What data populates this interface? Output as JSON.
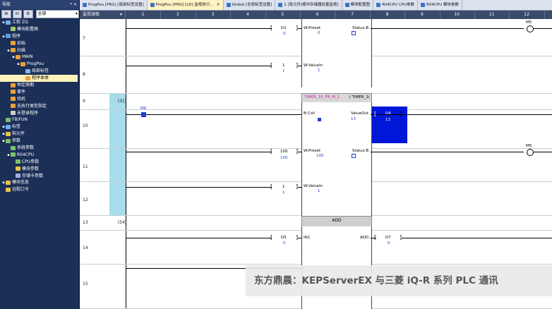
{
  "nav": {
    "title": "导航",
    "pin": "ᵠ ×",
    "select_value": "全部",
    "tree": [
      {
        "label": "工程 ZQ",
        "indent": 0,
        "exp": "▪",
        "color": "#6bb0f0"
      },
      {
        "label": "模块配置图",
        "indent": 1,
        "exp": "",
        "color": "#9cd067"
      },
      {
        "label": "程序",
        "indent": 0,
        "exp": "▪",
        "color": "#5aa0e0"
      },
      {
        "label": "初始",
        "indent": 1,
        "exp": "",
        "color": "#e8a23c"
      },
      {
        "label": "扫描",
        "indent": 1,
        "exp": "▪",
        "color": "#e8a23c"
      },
      {
        "label": "MAIN",
        "indent": 2,
        "exp": "▪",
        "color": "#e8a23c"
      },
      {
        "label": "ProgPou",
        "indent": 3,
        "exp": "▪",
        "color": "#e8a23c"
      },
      {
        "label": "局部标签",
        "indent": 4,
        "exp": "",
        "color": "#7ab3ef"
      },
      {
        "label": "程序本体",
        "indent": 4,
        "exp": "",
        "color": "#e8a23c",
        "selected": true
      },
      {
        "label": "恒定周期",
        "indent": 1,
        "exp": "",
        "color": "#e8a23c"
      },
      {
        "label": "事件",
        "indent": 1,
        "exp": "",
        "color": "#e8a23c"
      },
      {
        "label": "待机",
        "indent": 1,
        "exp": "",
        "color": "#e8a23c"
      },
      {
        "label": "无执行类型指定",
        "indent": 1,
        "exp": "",
        "color": "#e8a23c"
      },
      {
        "label": "未登录程序",
        "indent": 1,
        "exp": "",
        "color": "#cccccc"
      },
      {
        "label": "FB/FUN",
        "indent": 0,
        "exp": "",
        "color": "#7bc06a"
      },
      {
        "label": "标签",
        "indent": 0,
        "exp": "▪",
        "color": "#6bb0f0"
      },
      {
        "label": "软元件",
        "indent": 0,
        "exp": "▪",
        "color": "#e8c34a"
      },
      {
        "label": "参数",
        "indent": 0,
        "exp": "▪",
        "color": "#7bc06a"
      },
      {
        "label": "系统参数",
        "indent": 1,
        "exp": "",
        "color": "#7bc06a"
      },
      {
        "label": "R04CPU",
        "indent": 1,
        "exp": "▪",
        "color": "#7bc06a"
      },
      {
        "label": "CPU参数",
        "indent": 2,
        "exp": "",
        "color": "#7bc06a"
      },
      {
        "label": "模块参数",
        "indent": 2,
        "exp": "",
        "color": "#e8c34a"
      },
      {
        "label": "存储卡参数",
        "indent": 2,
        "exp": "",
        "color": "#9ab4e6"
      },
      {
        "label": "模块信息",
        "indent": 0,
        "exp": "▪",
        "color": "#e8c34a"
      },
      {
        "label": "远程口令",
        "indent": 0,
        "exp": "",
        "color": "#e8c34a"
      }
    ]
  },
  "tabs": [
    {
      "label": "ProgPou [PRG] [局部标签设置]",
      "active": false,
      "close": ""
    },
    {
      "label": "ProgPou [PRG] [LD] 监视执行...",
      "active": true,
      "close": "×"
    },
    {
      "label": "Global [全局标签设置]",
      "active": false,
      "close": ""
    },
    {
      "label": "1 [软元件/缓冲存储器批量监视]",
      "active": false,
      "close": ""
    },
    {
      "label": "模块配置图",
      "active": false,
      "close": ""
    },
    {
      "label": "R04CPU CPU参数",
      "active": false,
      "close": ""
    },
    {
      "label": "R04CPU 模块参数",
      "active": false,
      "close": ""
    }
  ],
  "header": {
    "mode": "监视读取",
    "columns": [
      "1",
      "2",
      "3",
      "4",
      "5",
      "6",
      "7",
      "8",
      "9",
      "10",
      "11",
      "12"
    ]
  },
  "rows": {
    "r7": "7",
    "r8": "8",
    "r9": "9",
    "r10": "10",
    "r11": "11",
    "r12": "12",
    "r13": "13",
    "r14": "14",
    "r15": "15",
    "step9": "(31)",
    "step13": "(54)"
  },
  "ladder": {
    "d1": "D1",
    "d1v": "0",
    "wpreset1": "W:Preset",
    "wpreset1v": "0",
    "statusb1": "Status:B",
    "m5": "M5",
    "one_a": "1",
    "one_av": "1",
    "wvaluein1": "W:ValueIn",
    "wvaluein1v": "1",
    "fbname": "TIMER_10_FB_M_1",
    "fbtype": "( TIMER_1(",
    "m6a": "M6",
    "bcoil": "B:Coil",
    "valueout": "ValueOut",
    "valueoutv": "13",
    "d4": "D4",
    "d4v": "13",
    "m6b": "M6",
    "hundred": "100",
    "hundredv": "100",
    "wpreset2": "W:Preset",
    "wpreset2v": "100",
    "statusb2": "Status:B",
    "one_b": "1",
    "one_bv": "1",
    "wvaluein2": "W:ValueIn",
    "wvaluein2v": "1",
    "add": "ADD",
    "d5": "D5",
    "d5v": "0",
    "in1": "IN1",
    "addout": "ADD",
    "d7": "D7",
    "d7v": "0"
  },
  "watermark": "东方鼎晨：KEPServerEX 与三菱 iQ-R 系列 PLC 通讯"
}
